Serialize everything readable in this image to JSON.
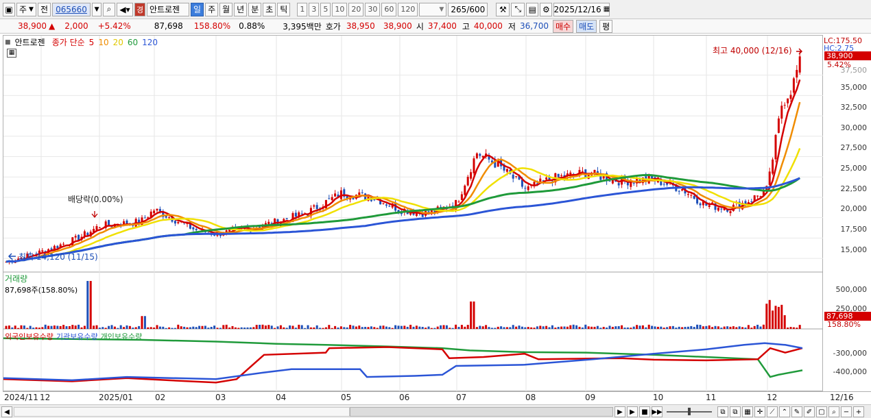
{
  "toolbar": {
    "market": "주",
    "prev": "전",
    "code": "065660",
    "badge": "경",
    "name": "안트로젠",
    "periods": [
      "일",
      "주",
      "월",
      "년",
      "분",
      "초",
      "틱"
    ],
    "counts": [
      "1",
      "3",
      "5",
      "10",
      "20",
      "30",
      "60",
      "120"
    ],
    "view_count": "265",
    "view_total": "/600",
    "date": "2025/12/16"
  },
  "quote": {
    "price": "38,900",
    "arrow": "▲",
    "change": "2,000",
    "change_pct": "+5.42%",
    "volume": "87,698",
    "volume_ratio": "158.80%",
    "turnover": "0.88%",
    "amount": "3,395백만",
    "ask_label": "호가",
    "ask": "38,950",
    "bid": "38,900",
    "open_label": "시",
    "open": "37,400",
    "high_label": "고",
    "high": "40,000",
    "low_label": "저",
    "low": "36,700",
    "buy": "매수",
    "sell": "매도",
    "eval": "평"
  },
  "price_chart": {
    "stock_name": "안트로젠",
    "ma_label": "종가 단순",
    "ma_periods": [
      "5",
      "10",
      "20",
      "60",
      "120"
    ],
    "ma_colors": [
      "#d40000",
      "#f08c00",
      "#f0e000",
      "#1f9a3a",
      "#2b55d6"
    ],
    "annotations": {
      "high": "최고 40,000 (12/16)",
      "low": "최저 14,120 (11/15)",
      "dividend": "배당락(0.00%)"
    },
    "ylabels": [
      "35,000",
      "32,500",
      "30,000",
      "27,500",
      "25,000",
      "22,500",
      "20,000",
      "17,500",
      "15,000"
    ],
    "last_price": "38,900",
    "last_pct": "5.42%",
    "lc_label": "LC:175.50",
    "hc_label": "HC:2.75",
    "top_partial": "37,500"
  },
  "volume_chart": {
    "title": "거래량",
    "value": "87,698주(158.80%)",
    "ylabels": [
      "500,000",
      "250,000"
    ],
    "last_value": "87,698",
    "last_pct": "158.80%"
  },
  "holdings_chart": {
    "legend": [
      "외국인보유수량",
      "기관보유수량",
      "개인보유수량"
    ],
    "legend_colors": [
      "#d40000",
      "#2b55d6",
      "#1f9a3a"
    ],
    "ylabels": [
      "-300,000",
      "-400,000"
    ]
  },
  "xaxis": {
    "labels": [
      "2024/11",
      "12",
      "2025/01",
      "02",
      "03",
      "04",
      "05",
      "06",
      "07",
      "08",
      "09",
      "10",
      "11",
      "12",
      "12/16"
    ]
  },
  "chart_data": {
    "type": "line",
    "title": "",
    "x": [
      "2024/11",
      "12",
      "2025/01",
      "02",
      "03",
      "04",
      "05",
      "06",
      "07",
      "08",
      "09",
      "10",
      "11",
      "12",
      "12/16"
    ],
    "series": [
      {
        "name": "5",
        "values": [
          14500,
          17000,
          19500,
          19000,
          18200,
          19800,
          23500,
          20500,
          27500,
          23500,
          25000,
          24500,
          21500,
          24000,
          38900
        ]
      },
      {
        "name": "120",
        "values": [
          15000,
          15500,
          16200,
          17200,
          17800,
          18600,
          19400,
          20300,
          21100,
          21900,
          22800,
          23500,
          23400,
          23300,
          25000
        ]
      }
    ],
    "ylim": [
      14000,
      40500
    ]
  }
}
